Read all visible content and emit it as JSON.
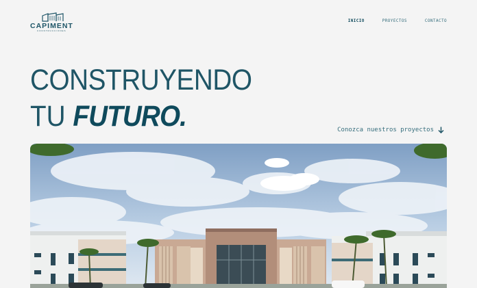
{
  "brand": {
    "name": "CAPIMENT",
    "subtitle": "CONSTRUCCIONES"
  },
  "nav": {
    "items": [
      {
        "label": "INICIO",
        "active": true
      },
      {
        "label": "PROYECTOS",
        "active": false
      },
      {
        "label": "CONTACTO",
        "active": false
      }
    ]
  },
  "hero": {
    "line1": "CONSTRUYENDO",
    "line2_prefix": "TU",
    "line2_emphasis": "FUTURO.",
    "cta_label": "Conozca nuestros proyectos",
    "cta_icon": "arrow-down-icon"
  },
  "colors": {
    "background": "#f4f4f4",
    "primary": "#1f5566",
    "accent": "#0f4a5c"
  }
}
